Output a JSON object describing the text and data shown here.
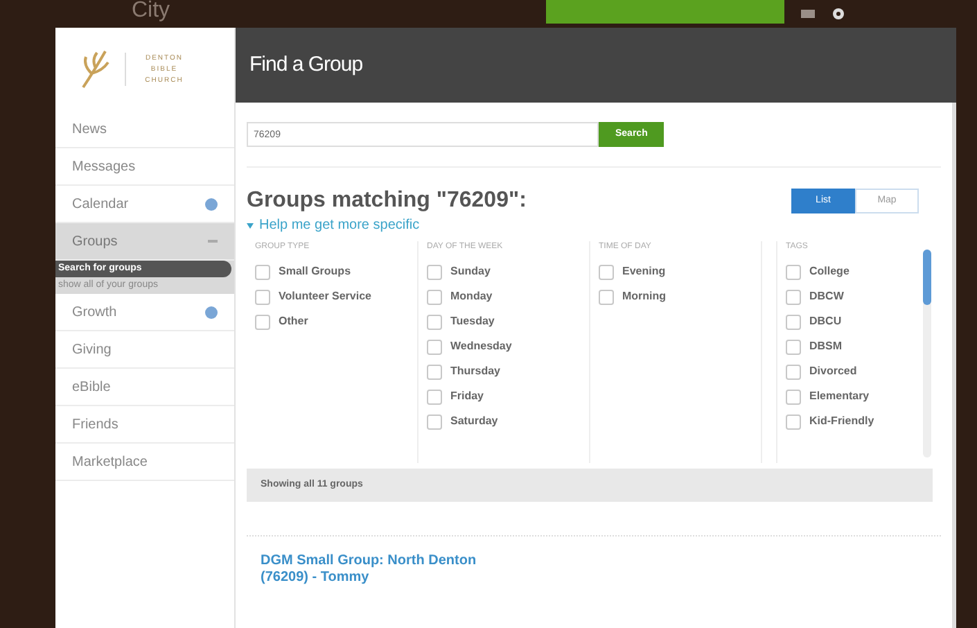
{
  "brand": {
    "top_logo": "City",
    "church": "DENTON BIBLE CHURCH"
  },
  "header": {
    "title": "Find a Group"
  },
  "sidebar": {
    "items": [
      {
        "label": "News",
        "selected": false,
        "badge": false
      },
      {
        "label": "Messages",
        "selected": false,
        "badge": false
      },
      {
        "label": "Calendar",
        "selected": false,
        "badge": true
      },
      {
        "label": "Groups",
        "selected": true,
        "badge": false,
        "children": [
          {
            "label": "Search for groups",
            "selected": true
          },
          {
            "label": "show all of your groups",
            "selected": false
          }
        ]
      },
      {
        "label": "Growth",
        "selected": false,
        "badge": true
      },
      {
        "label": "Giving",
        "selected": false,
        "badge": false
      },
      {
        "label": "eBible",
        "selected": false,
        "badge": false
      },
      {
        "label": "Friends",
        "selected": false,
        "badge": false
      },
      {
        "label": "Marketplace",
        "selected": false,
        "badge": false
      }
    ]
  },
  "search": {
    "value": "76209",
    "button": "Search"
  },
  "results_heading": "Groups matching \"76209\":",
  "view_toggle": [
    {
      "label": "List",
      "selected": true
    },
    {
      "label": "Map",
      "selected": false
    }
  ],
  "filter_link": "Help me get more specific",
  "filters": [
    {
      "heading": "GROUP TYPE",
      "options": [
        {
          "label": "Small Groups",
          "checked": false
        },
        {
          "label": "Volunteer Service",
          "checked": false
        },
        {
          "label": "Other",
          "checked": false
        }
      ]
    },
    {
      "heading": "DAY OF THE WEEK",
      "options": [
        {
          "label": "Sunday",
          "checked": false
        },
        {
          "label": "Monday",
          "checked": false
        },
        {
          "label": "Tuesday",
          "checked": false
        },
        {
          "label": "Wednesday",
          "checked": false
        },
        {
          "label": "Thursday",
          "checked": false
        },
        {
          "label": "Friday",
          "checked": false
        },
        {
          "label": "Saturday",
          "checked": false
        }
      ]
    },
    {
      "heading": "TIME OF DAY",
      "options": [
        {
          "label": "Evening",
          "checked": false
        },
        {
          "label": "Morning",
          "checked": false
        }
      ]
    },
    {
      "heading": "TAGS",
      "options": [
        {
          "label": "College",
          "checked": false
        },
        {
          "label": "DBCW",
          "checked": false
        },
        {
          "label": "DBCU",
          "checked": false
        },
        {
          "label": "DBSM",
          "checked": false
        },
        {
          "label": "Divorced",
          "checked": false
        },
        {
          "label": "Elementary",
          "checked": false
        },
        {
          "label": "Kid-Friendly",
          "checked": false
        }
      ]
    }
  ],
  "results_count": "Showing all 11 groups",
  "results": [
    {
      "title": "DGM Small Group: North Denton (76209) - Tommy"
    }
  ]
}
